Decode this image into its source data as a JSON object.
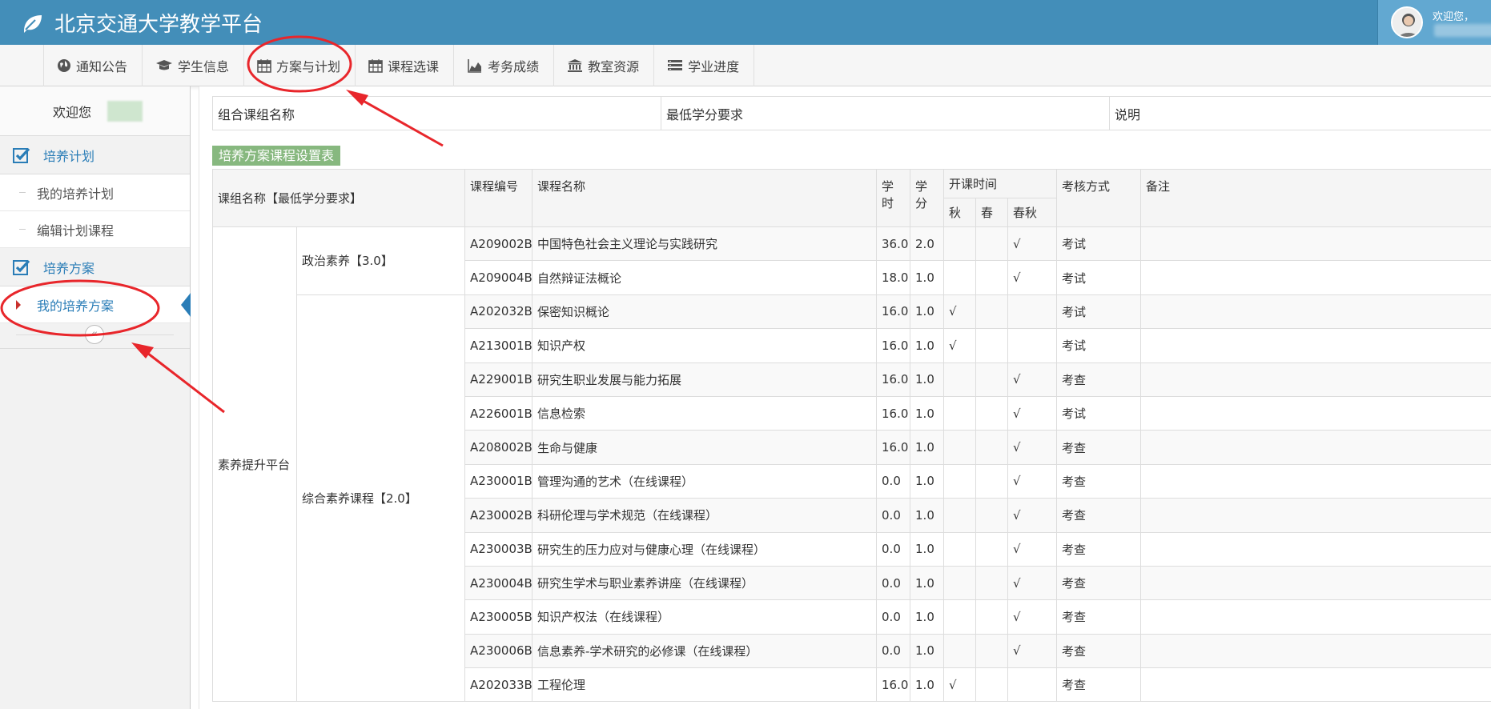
{
  "app": {
    "title": "北京交通大学教学平台"
  },
  "user": {
    "greeting": "欢迎您，"
  },
  "nav": [
    {
      "label": "通知公告",
      "icon": "globe-icon"
    },
    {
      "label": "学生信息",
      "icon": "graduation-cap-icon"
    },
    {
      "label": "方案与计划",
      "icon": "calendar-icon"
    },
    {
      "label": "课程选课",
      "icon": "calendar-icon"
    },
    {
      "label": "考务成绩",
      "icon": "area-chart-icon"
    },
    {
      "label": "教室资源",
      "icon": "institution-icon"
    },
    {
      "label": "学业进度",
      "icon": "list-icon"
    }
  ],
  "sidebar": {
    "welcome": "欢迎您",
    "sections": [
      {
        "label": "培养计划",
        "items": [
          "我的培养计划",
          "编辑计划课程"
        ]
      },
      {
        "label": "培养方案",
        "items": [
          "我的培养方案"
        ]
      }
    ],
    "collapse_glyph": "«"
  },
  "top_table": {
    "col1": "组合课组名称",
    "col2": "最低学分要求",
    "col3": "说明"
  },
  "section_label": "培养方案课程设置表",
  "course_table": {
    "headers": {
      "group": "课组名称【最低学分要求】",
      "code": "课程编号",
      "name": "课程名称",
      "hours": "学时",
      "credits": "学分",
      "term": "开课时间",
      "autumn": "秋",
      "spring": "春",
      "both": "春秋",
      "exam": "考核方式",
      "remark": "备注"
    },
    "group_main": "素养提升平台",
    "sub_groups": [
      {
        "label": "政治素养【3.0】"
      },
      {
        "label": "综合素养课程【2.0】"
      }
    ],
    "rows": [
      {
        "code": "A209002B",
        "name": "中国特色社会主义理论与实践研究",
        "hours": "36.0",
        "credits": "2.0",
        "autumn": "",
        "spring": "",
        "both": "√",
        "exam": "考试"
      },
      {
        "code": "A209004B",
        "name": "自然辩证法概论",
        "hours": "18.0",
        "credits": "1.0",
        "autumn": "",
        "spring": "",
        "both": "√",
        "exam": "考试"
      },
      {
        "code": "A202032B",
        "name": "保密知识概论",
        "hours": "16.0",
        "credits": "1.0",
        "autumn": "√",
        "spring": "",
        "both": "",
        "exam": "考试"
      },
      {
        "code": "A213001B",
        "name": "知识产权",
        "hours": "16.0",
        "credits": "1.0",
        "autumn": "√",
        "spring": "",
        "both": "",
        "exam": "考试"
      },
      {
        "code": "A229001B",
        "name": "研究生职业发展与能力拓展",
        "hours": "16.0",
        "credits": "1.0",
        "autumn": "",
        "spring": "",
        "both": "√",
        "exam": "考查"
      },
      {
        "code": "A226001B",
        "name": "信息检索",
        "hours": "16.0",
        "credits": "1.0",
        "autumn": "",
        "spring": "",
        "both": "√",
        "exam": "考试"
      },
      {
        "code": "A208002B",
        "name": "生命与健康",
        "hours": "16.0",
        "credits": "1.0",
        "autumn": "",
        "spring": "",
        "both": "√",
        "exam": "考查"
      },
      {
        "code": "A230001B",
        "name": "管理沟通的艺术（在线课程）",
        "hours": "0.0",
        "credits": "1.0",
        "autumn": "",
        "spring": "",
        "both": "√",
        "exam": "考查"
      },
      {
        "code": "A230002B",
        "name": "科研伦理与学术规范（在线课程）",
        "hours": "0.0",
        "credits": "1.0",
        "autumn": "",
        "spring": "",
        "both": "√",
        "exam": "考查"
      },
      {
        "code": "A230003B",
        "name": "研究生的压力应对与健康心理（在线课程）",
        "hours": "0.0",
        "credits": "1.0",
        "autumn": "",
        "spring": "",
        "both": "√",
        "exam": "考查"
      },
      {
        "code": "A230004B",
        "name": "研究生学术与职业素养讲座（在线课程）",
        "hours": "0.0",
        "credits": "1.0",
        "autumn": "",
        "spring": "",
        "both": "√",
        "exam": "考查"
      },
      {
        "code": "A230005B",
        "name": "知识产权法（在线课程）",
        "hours": "0.0",
        "credits": "1.0",
        "autumn": "",
        "spring": "",
        "both": "√",
        "exam": "考查"
      },
      {
        "code": "A230006B",
        "name": "信息素养-学术研究的必修课（在线课程）",
        "hours": "0.0",
        "credits": "1.0",
        "autumn": "",
        "spring": "",
        "both": "√",
        "exam": "考查"
      },
      {
        "code": "A202033B",
        "name": "工程伦理",
        "hours": "16.0",
        "credits": "1.0",
        "autumn": "√",
        "spring": "",
        "both": "",
        "exam": "考查"
      }
    ]
  },
  "colors": {
    "header": "#438eb9",
    "accent": "#2a7db7",
    "label_green": "#87b87f",
    "annotation": "#e8262b"
  }
}
